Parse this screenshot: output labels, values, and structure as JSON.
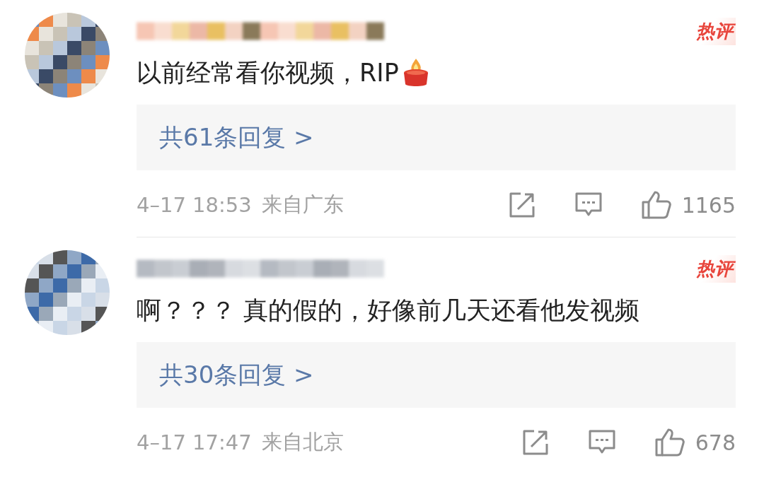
{
  "comments": [
    {
      "badge": "热评",
      "text": "以前经常看你视频，RIP",
      "candle": true,
      "replies": "共61条回复 >",
      "time": "4–17 18:53",
      "location": "来自广东",
      "likes": "1165"
    },
    {
      "badge": "热评",
      "text": "啊？？？ 真的假的，好像前几天还看他发视频",
      "candle": false,
      "replies": "共30条回复 >",
      "time": "4–17 17:47",
      "location": "来自北京",
      "likes": "678"
    }
  ]
}
